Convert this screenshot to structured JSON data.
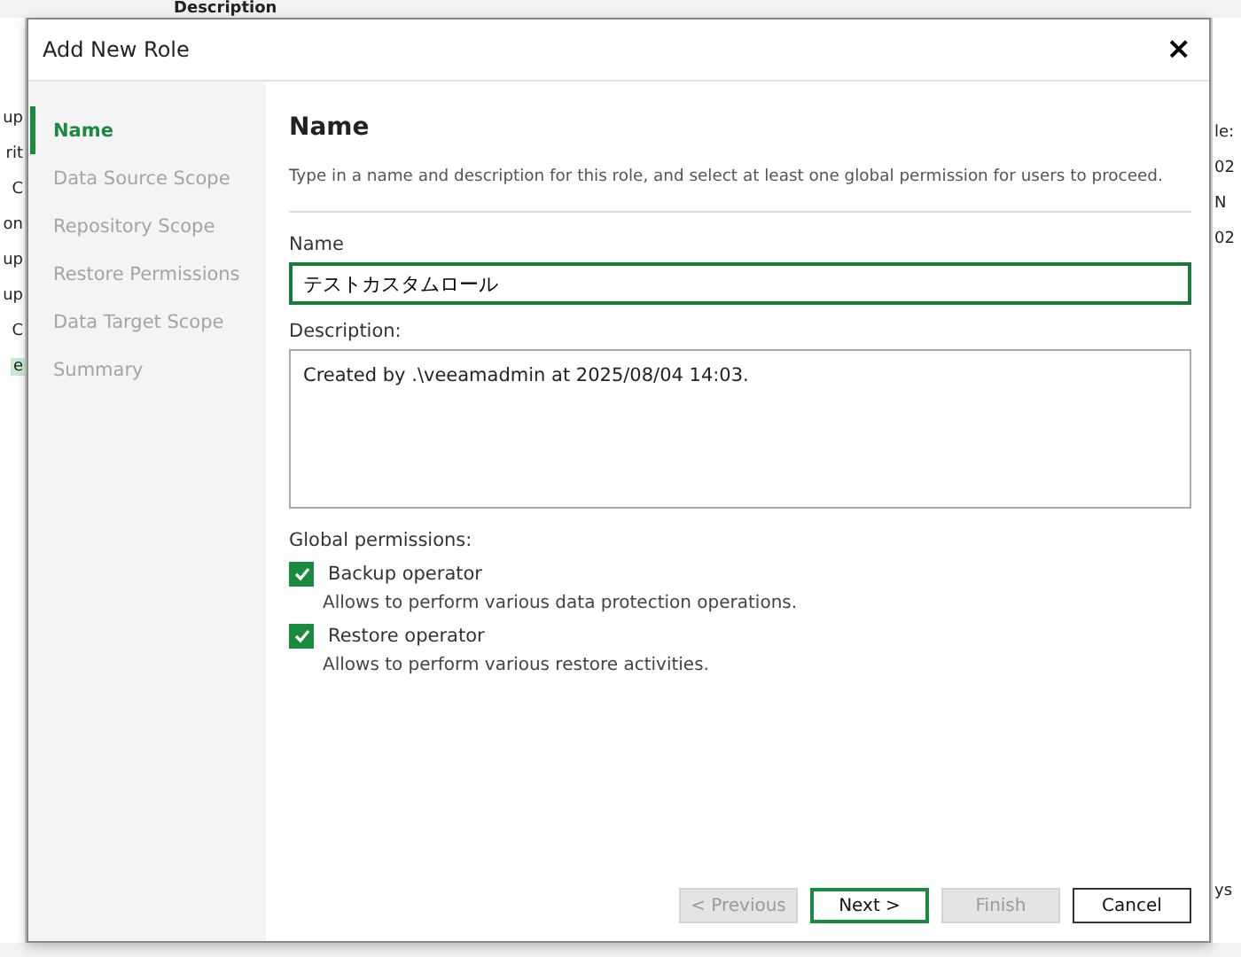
{
  "background": {
    "header": "Description",
    "left_fragments": [
      {
        "text": "up",
        "selected": false
      },
      {
        "text": "rit",
        "selected": false
      },
      {
        "text": "C",
        "selected": false
      },
      {
        "text": "on",
        "selected": false
      },
      {
        "text": "up",
        "selected": false
      },
      {
        "text": "up",
        "selected": false
      },
      {
        "text": "C",
        "selected": false
      },
      {
        "text": "e",
        "selected": true
      }
    ],
    "right_fragments": [
      "le:",
      "02",
      "N",
      "02"
    ],
    "bottom_right": "ys"
  },
  "window": {
    "title": "Add New Role",
    "close": "×"
  },
  "steps": [
    {
      "label": "Name",
      "selected": true
    },
    {
      "label": "Data Source Scope",
      "selected": false
    },
    {
      "label": "Repository Scope",
      "selected": false
    },
    {
      "label": "Restore Permissions",
      "selected": false
    },
    {
      "label": "Data Target Scope",
      "selected": false
    },
    {
      "label": "Summary",
      "selected": false
    }
  ],
  "heading": "Name",
  "intro": "Type in a name and description for this role, and select at least one global permission for users to proceed.",
  "name_field": {
    "label": "Name",
    "value": "テストカスタムロール"
  },
  "description_field": {
    "label": "Description:",
    "value": "Created by .\\veeamadmin at 2025/08/04 14:03."
  },
  "permissions_label": "Global permissions:",
  "permissions": [
    {
      "label": "Backup operator",
      "checked": true,
      "hint": "Allows to perform various data protection operations."
    },
    {
      "label": "Restore operator",
      "checked": true,
      "hint": "Allows to perform various restore activities."
    }
  ],
  "buttons": [
    {
      "label": "< Previous",
      "disabled": true,
      "default": false
    },
    {
      "label": "Next >",
      "disabled": false,
      "default": true
    },
    {
      "label": "Finish",
      "disabled": true,
      "default": false
    },
    {
      "label": "Cancel",
      "disabled": false,
      "default": false
    }
  ]
}
